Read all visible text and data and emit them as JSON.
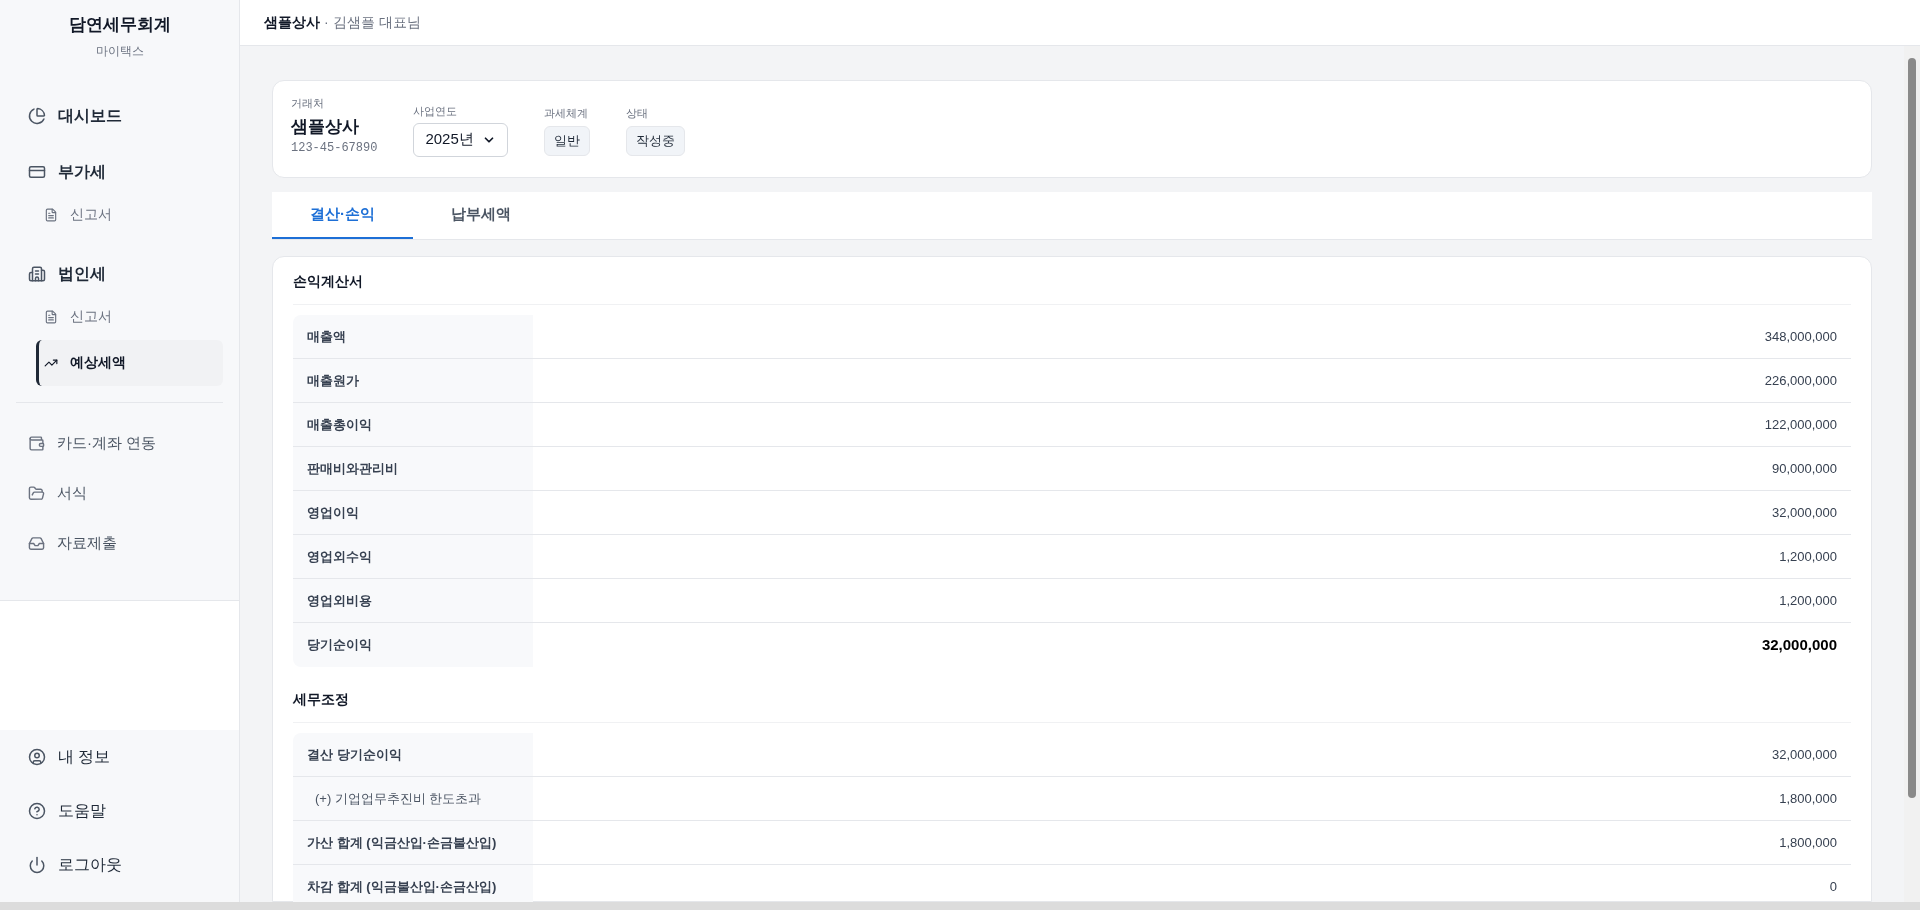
{
  "sidebar": {
    "brand": "담연세무회계",
    "subtitle": "마이택스",
    "items": [
      {
        "label": "대시보드",
        "kind": "section",
        "selected": false
      },
      {
        "label": "부가세",
        "kind": "section",
        "selected": false
      },
      {
        "label": "신고서",
        "kind": "sub",
        "selected": false
      },
      {
        "label": "법인세",
        "kind": "section",
        "selected": false
      },
      {
        "label": "신고서",
        "kind": "sub",
        "selected": false
      },
      {
        "label": "예상세액",
        "kind": "sub",
        "selected": true
      },
      {
        "kind": "divider"
      },
      {
        "label": "카드·계좌 연동",
        "kind": "plain",
        "selected": false
      },
      {
        "label": "서식",
        "kind": "plain",
        "selected": false
      },
      {
        "label": "자료제출",
        "kind": "plain",
        "selected": false
      }
    ],
    "footer": [
      {
        "label": "내 정보"
      },
      {
        "label": "도움말"
      },
      {
        "label": "로그아웃"
      }
    ]
  },
  "header": {
    "company": "샘플상사",
    "separator": "·",
    "person": "김샘플 대표님"
  },
  "info": {
    "client_label": "거래처",
    "client_name": "샘플상사",
    "client_id": "123-45-67890",
    "year_label": "사업연도",
    "year_value": "2025년",
    "tax_label": "과세체계",
    "tax_value": "일반",
    "status_label": "상태",
    "status_value": "작성중"
  },
  "tabs": [
    {
      "label": "결산·손익",
      "selected": true
    },
    {
      "label": "납부세액",
      "selected": false
    }
  ],
  "sections": [
    {
      "title": "손익계산서",
      "rows": [
        {
          "label": "매출액",
          "value": "348,000,000",
          "kind": "normal"
        },
        {
          "label": "매출원가",
          "value": "226,000,000",
          "kind": "normal"
        },
        {
          "label": "매출총이익",
          "value": "122,000,000",
          "kind": "normal"
        },
        {
          "label": "판매비와관리비",
          "value": "90,000,000",
          "kind": "normal"
        },
        {
          "label": "영업이익",
          "value": "32,000,000",
          "kind": "normal"
        },
        {
          "label": "영업외수익",
          "value": "1,200,000",
          "kind": "normal"
        },
        {
          "label": "영업외비용",
          "value": "1,200,000",
          "kind": "normal"
        },
        {
          "label": "당기순이익",
          "value": "32,000,000",
          "kind": "total"
        }
      ]
    },
    {
      "title": "세무조정",
      "rows": [
        {
          "label": "결산 당기순이익",
          "value": "32,000,000",
          "kind": "normal"
        },
        {
          "label": "(+) 기업업무추진비 한도초과",
          "value": "1,800,000",
          "kind": "detail"
        },
        {
          "label": "가산 합계 (익금산입·손금불산입)",
          "value": "1,800,000",
          "kind": "normal"
        },
        {
          "label": "차감 합계 (익금불산입·손금산입)",
          "value": "0",
          "kind": "normal"
        }
      ]
    }
  ]
}
